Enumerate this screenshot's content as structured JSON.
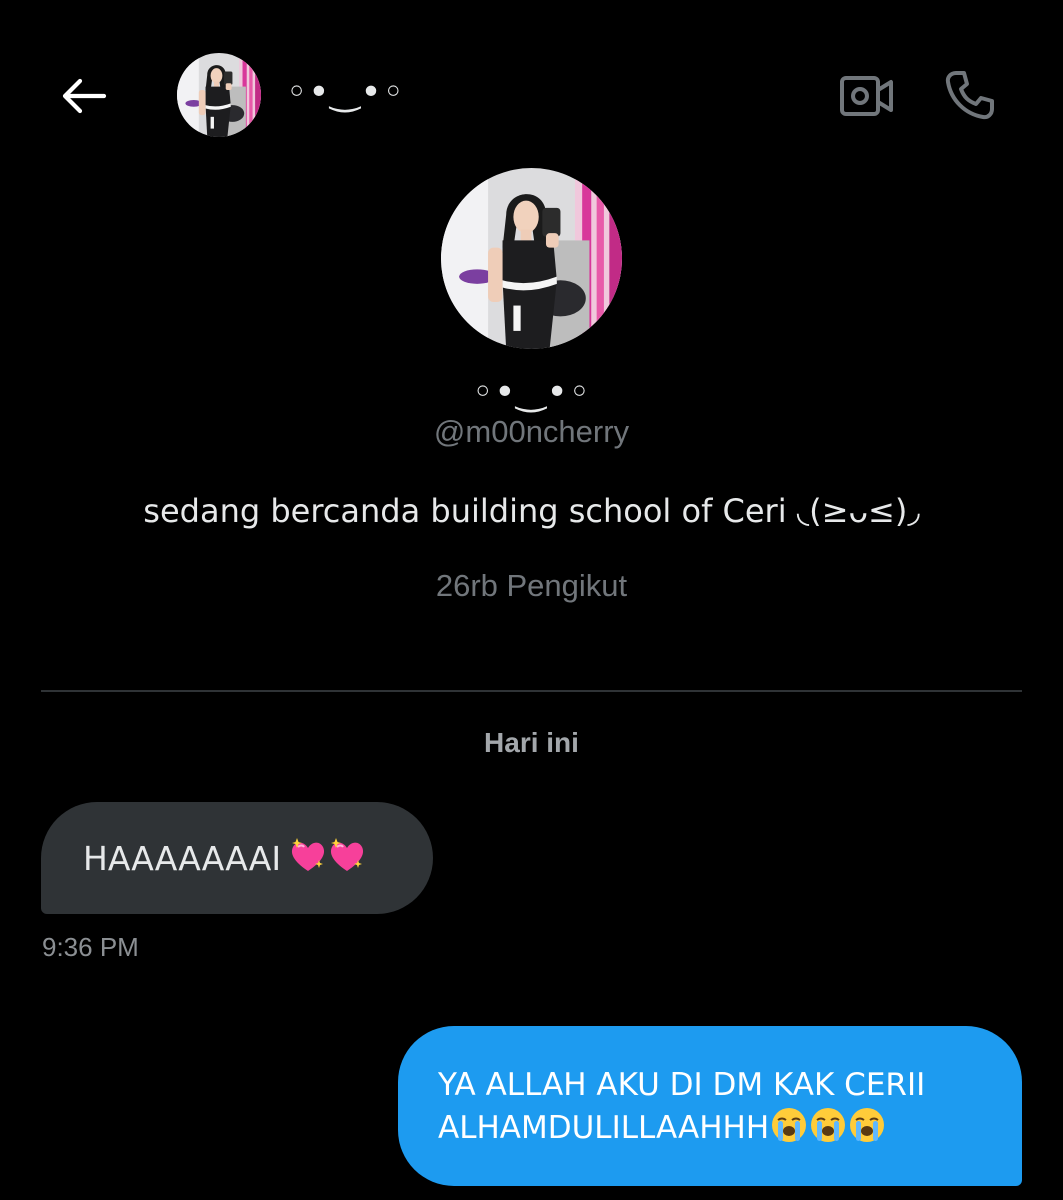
{
  "header": {
    "display_name": "◦•‿•◦",
    "back_icon": "arrow-left-icon",
    "video_icon": "video-camera-icon",
    "call_icon": "phone-icon"
  },
  "profile": {
    "display_name": "◦•‿•◦",
    "handle": "@m00ncherry",
    "bio": "sedang bercanda building school of Ceri ◟(≥ᴗ≤)◞",
    "followers": "26rb Pengikut"
  },
  "conversation": {
    "date_label": "Hari ini",
    "messages": [
      {
        "direction": "incoming",
        "text": "HAAAAAAAI",
        "emoji": [
          "sparkling-heart",
          "sparkling-heart"
        ],
        "time": "9:36 PM"
      },
      {
        "direction": "outgoing",
        "line1": "YA ALLAH AKU DI DM KAK CERII",
        "line2": "ALHAMDULILLAAHHH",
        "emoji": [
          "loudly-crying-face",
          "loudly-crying-face",
          "loudly-crying-face"
        ]
      }
    ]
  },
  "colors": {
    "background": "#000000",
    "primary_text": "#e7e9ea",
    "secondary_text": "#71767b",
    "incoming_bubble": "#2f3336",
    "outgoing_bubble": "#1d9bf0",
    "divider": "#2f3336"
  }
}
